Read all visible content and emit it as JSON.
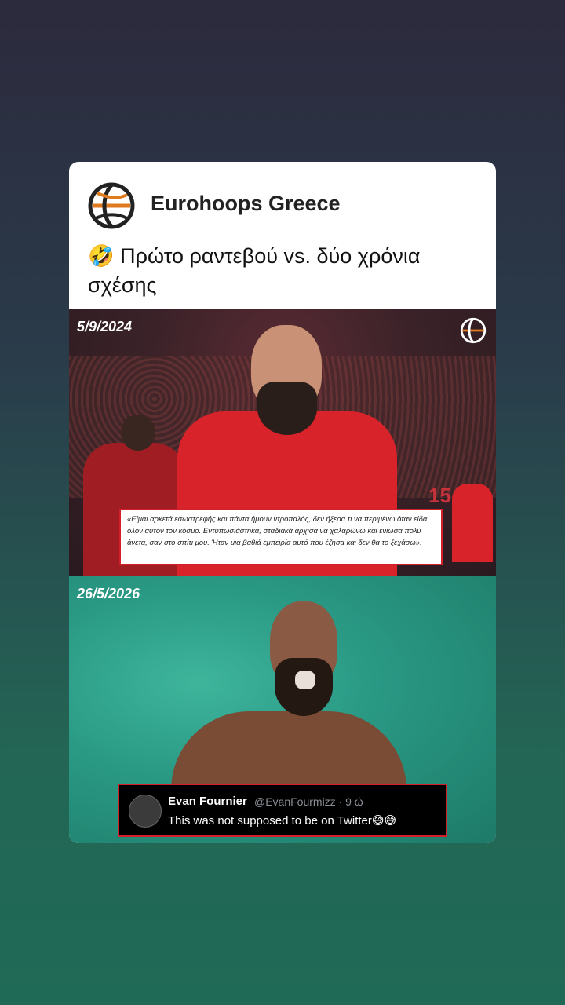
{
  "post": {
    "page_name": "Eurohoops Greece",
    "caption_emoji": "🤣",
    "caption_text": "Πρώτο ραντεβού vs. δύο χρόνια σχέσης"
  },
  "image_top": {
    "date": "5/9/2024",
    "jersey_number": "15",
    "quote": "«Είμαι αρκετά εσωστρεφής και πάντα ήμουν ντροπαλός, δεν ήξερα τι να περιμένω όταν είδα όλον αυτόν τον κόσμο. Εντυπωσιάστηκα, σταδιακά άρχισα να χαλαρώνω και ένιωσα πολύ άνετα, σαν στο σπίτι μου. Ήταν μια βαθιά εμπειρία αυτό που έζησα και δεν θα το ξεχάσω»."
  },
  "image_bottom": {
    "date": "26/5/2026",
    "tweet": {
      "name": "Evan Fournier",
      "handle": "@EvanFourmizz · 9 ώ",
      "text": "This was not supposed to be on Twitter",
      "emoji": "😅😅"
    }
  },
  "colors": {
    "background_top": "#2c2a3d",
    "background_bottom": "#1f6a56",
    "accent_red": "#d21f2a",
    "logo_orange": "#e07a1f"
  },
  "icons": {
    "page_logo": "eurohoops-ball-logo",
    "corner_logo": "eurohoops-watermark-logo"
  }
}
